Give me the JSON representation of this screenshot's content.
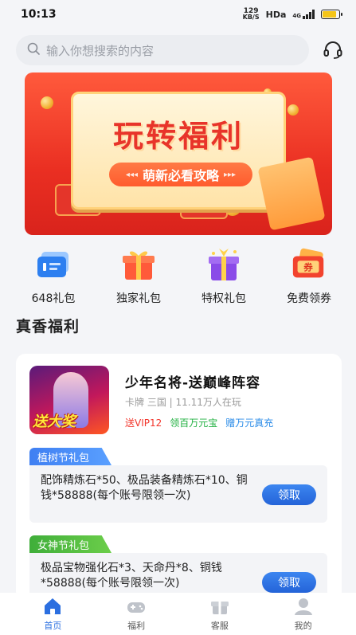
{
  "status_bar": {
    "time": "10:13",
    "net_speed_value": "129",
    "net_speed_unit": "KB/S",
    "network": "HDa",
    "signal_label": "4G"
  },
  "search": {
    "placeholder": "输入你想搜索的内容"
  },
  "banner": {
    "title": "玩转福利",
    "subtitle": "萌新必看攻略"
  },
  "quick_actions": [
    {
      "label": "648礼包",
      "icon": "ticket-icon"
    },
    {
      "label": "独家礼包",
      "icon": "gift-box-icon"
    },
    {
      "label": "特权礼包",
      "icon": "privilege-gift-icon"
    },
    {
      "label": "免费领券",
      "icon": "coupon-icon"
    }
  ],
  "section": {
    "title": "真香福利"
  },
  "game": {
    "name": "少年名将-送巅峰阵容",
    "meta": "卡牌 三国 | 11.11万人在玩",
    "cover_text": "送大奖",
    "tags": [
      "送VIP12",
      "领百万元宝",
      "赠万元真充"
    ]
  },
  "gifts": [
    {
      "tab": "植树节礼包",
      "desc": "配饰精炼石*50、极品装备精炼石*10、铜钱*58888(每个账号限领一次)",
      "button": "领取"
    },
    {
      "tab": "女神节礼包",
      "desc": "极品宝物强化石*3、天命丹*8、铜钱*58888(每个账号限领一次)",
      "button": "领取"
    }
  ],
  "tabbar": [
    {
      "label": "首页",
      "active": true
    },
    {
      "label": "福利",
      "active": false
    },
    {
      "label": "客服",
      "active": false
    },
    {
      "label": "我的",
      "active": false
    }
  ],
  "colors": {
    "accent_blue": "#2b6fe0",
    "banner_red": "#ea2f22",
    "tag_red": "#f2352b",
    "tag_green": "#20b040",
    "tag_blue": "#2b8ce8"
  }
}
